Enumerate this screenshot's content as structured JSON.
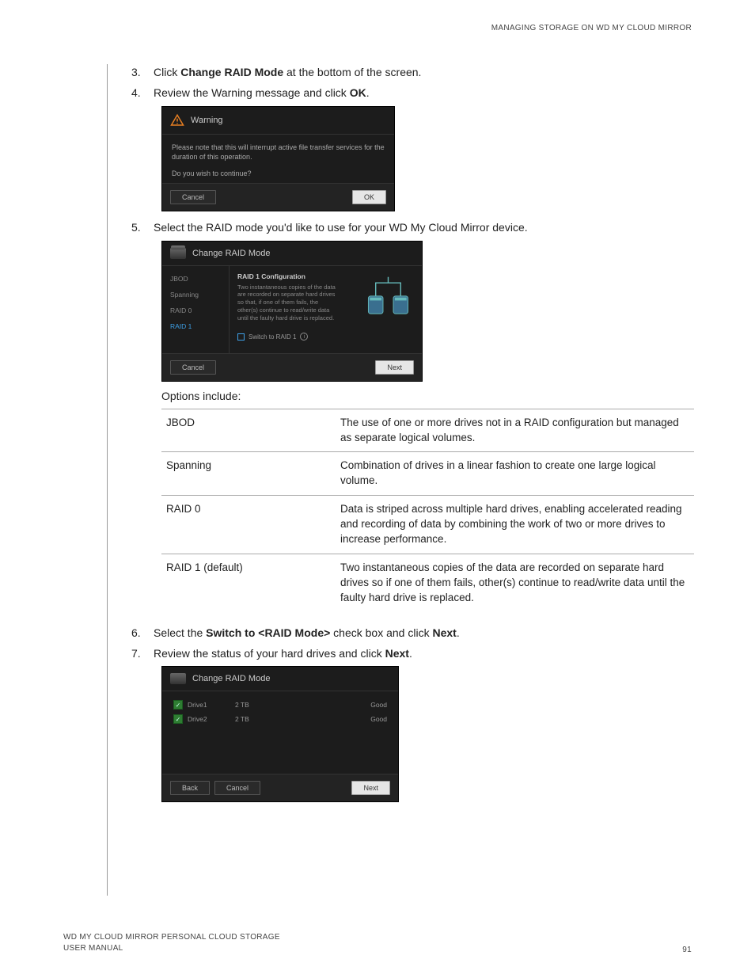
{
  "header": "MANAGING STORAGE ON WD MY CLOUD MIRROR",
  "steps": {
    "s3": {
      "num": "3.",
      "pre": "Click ",
      "bold": "Change RAID Mode",
      "post": " at the bottom of the screen."
    },
    "s4": {
      "num": "4.",
      "pre": "Review the Warning message and click ",
      "bold": "OK",
      "post": "."
    },
    "s5": {
      "num": "5.",
      "txt": "Select the RAID mode you'd like to use for your WD My Cloud Mirror device."
    },
    "s6": {
      "num": "6.",
      "pre": "Select the ",
      "bold": "Switch to <RAID Mode>",
      "mid": " check box and click ",
      "bold2": "Next",
      "post": "."
    },
    "s7": {
      "num": "7.",
      "pre": "Review the status of your hard drives and click ",
      "bold": "Next",
      "post": "."
    }
  },
  "warning_dialog": {
    "title": "Warning",
    "body": "Please note that this will interrupt active file transfer services for the duration of this operation.",
    "question": "Do you wish to continue?",
    "cancel": "Cancel",
    "ok": "OK"
  },
  "raid_dialog": {
    "title": "Change RAID Mode",
    "options": [
      "JBOD",
      "Spanning",
      "RAID 0",
      "RAID 1"
    ],
    "selected": "RAID 1",
    "config_title": "RAID 1 Configuration",
    "config_desc": "Two instantaneous copies of the data are recorded on separate hard drives so that, if one of them fails, the other(s) continue to read/write data until the faulty hard drive is replaced.",
    "switch_label": "Switch to RAID 1",
    "cancel": "Cancel",
    "next": "Next"
  },
  "options_caption": "Options include:",
  "options_table": [
    {
      "name": "JBOD",
      "desc": "The use of one or more drives not in a RAID configuration but managed as separate logical volumes."
    },
    {
      "name": "Spanning",
      "desc": "Combination of drives in a linear fashion to create one large logical volume."
    },
    {
      "name": "RAID 0",
      "desc": "Data is striped across multiple hard drives, enabling accelerated reading and recording of data by combining the work of two or more drives to increase performance."
    },
    {
      "name": "RAID 1 (default)",
      "desc": "Two instantaneous copies of the data are recorded on separate hard drives so if one of them fails, other(s) continue to read/write data until the faulty hard drive is replaced."
    }
  ],
  "drive_dialog": {
    "title": "Change RAID Mode",
    "drives": [
      {
        "name": "Drive1",
        "size": "2 TB",
        "status": "Good"
      },
      {
        "name": "Drive2",
        "size": "2 TB",
        "status": "Good"
      }
    ],
    "back": "Back",
    "cancel": "Cancel",
    "next": "Next"
  },
  "footer": {
    "line1": "WD MY CLOUD MIRROR PERSONAL CLOUD STORAGE",
    "line2": "USER MANUAL",
    "page": "91"
  }
}
